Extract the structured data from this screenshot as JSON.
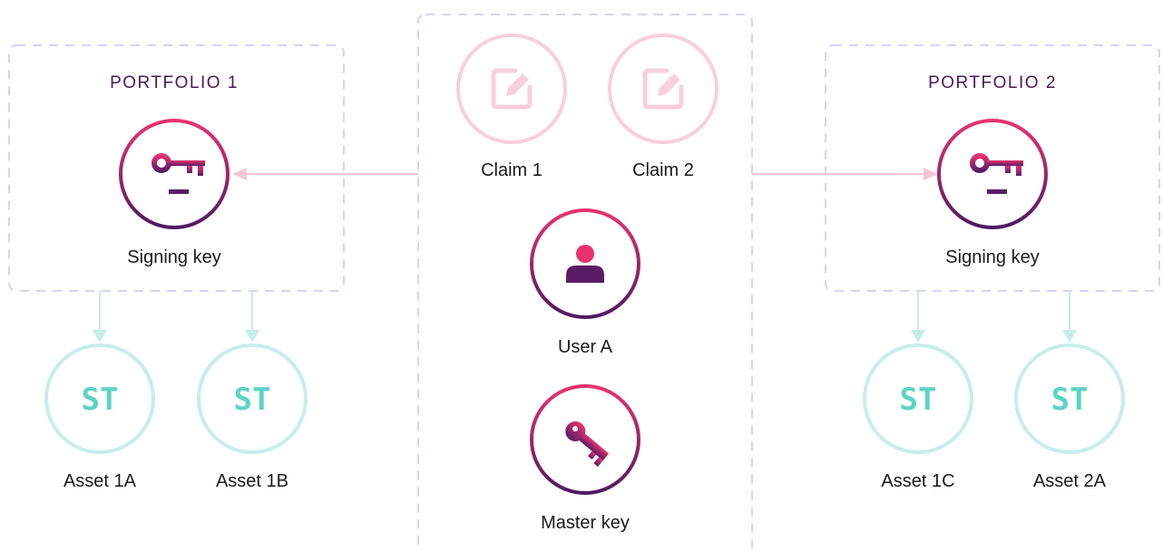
{
  "portfolio_1": {
    "title": "PORTFOLIO 1",
    "signing_key_label": "Signing key",
    "assets": [
      {
        "badge": "ST",
        "label": "Asset 1A"
      },
      {
        "badge": "ST",
        "label": "Asset 1B"
      }
    ]
  },
  "portfolio_2": {
    "title": "PORTFOLIO 2",
    "signing_key_label": "Signing key",
    "assets": [
      {
        "badge": "ST",
        "label": "Asset 1C"
      },
      {
        "badge": "ST",
        "label": "Asset 2A"
      }
    ]
  },
  "identity": {
    "claims": [
      {
        "label": "Claim 1"
      },
      {
        "label": "Claim 2"
      }
    ],
    "user_label": "User A",
    "master_key_label": "Master key"
  },
  "colors": {
    "dashed_border": "#d9d2f5",
    "gradient_start": "#e8336f",
    "gradient_end": "#4f1a62",
    "claim_tint": "#f8cfdd",
    "asset_tint": "#c7eee8",
    "st_text": "#5dd4c4",
    "title_text": "#4a1a5a"
  },
  "icons": {
    "claim": "edit-icon",
    "signing_key": "signing-key-icon",
    "user": "user-icon",
    "master_key": "master-key-icon"
  }
}
